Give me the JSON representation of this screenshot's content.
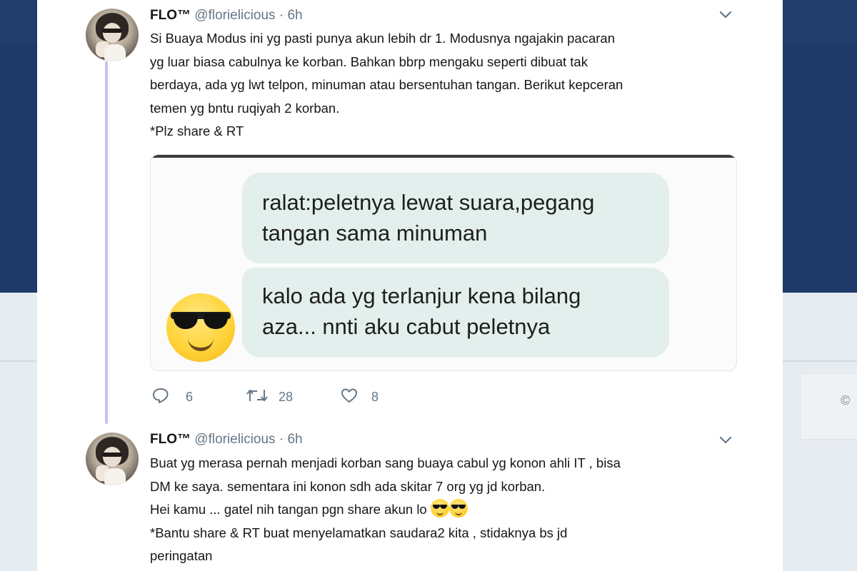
{
  "tweets": [
    {
      "name": "FLO™",
      "handle": "@florielicious",
      "separator": "·",
      "time": "6h",
      "text_lines": [
        "Si Buaya Modus ini yg pasti punya akun lebih dr 1. Modusnya ngajakin pacaran",
        "yg luar biasa cabulnya ke korban. Bahkan bbrp mengaku seperti dibuat tak",
        "berdaya, ada yg lwt telpon, minuman atau bersentuhan tangan. Berikut kepceran",
        "temen yg bntu ruqiyah 2 korban.",
        "*Plz share & RT"
      ],
      "media": {
        "bubble1": [
          "ralat:peletnya lewat suara,pegang",
          "tangan sama minuman"
        ],
        "bubble2": [
          "kalo ada yg terlanjur kena bilang",
          "aza... nnti aku cabut peletnya"
        ],
        "emoji": "sunglasses-emoji"
      },
      "replies": "6",
      "retweets": "28",
      "likes": "8"
    },
    {
      "name": "FLO™",
      "handle": "@florielicious",
      "separator": "·",
      "time": "6h",
      "text_lines": [
        "Buat yg merasa pernah menjadi korban sang buaya cabul yg konon ahli IT , bisa",
        "DM ke saya. sementara ini konon sdh ada skitar 7 org yg jd korban.",
        "Hei kamu ... gatel nih tangan pgn share akun lo",
        "*Bantu share & RT buat menyelamatkan saudara2 kita , stidaknya bs jd",
        "peringatan"
      ]
    }
  ],
  "background": {
    "corner_glyph": "©"
  },
  "colors": {
    "text": "#14171a",
    "muted": "#657786",
    "thread_line": "#c9c2f0",
    "bubble": "#e3efec"
  }
}
